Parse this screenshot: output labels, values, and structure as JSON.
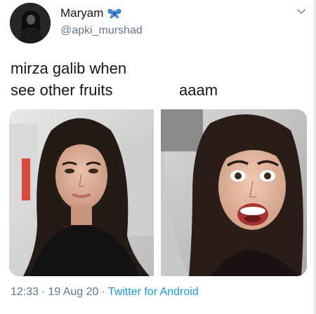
{
  "author": {
    "display_name": "Maryam",
    "handle": "@apki_murshad",
    "name_emoji": "butterfly-icon"
  },
  "tweet": {
    "line1": "mirza galib when",
    "line2": "see other fruits",
    "line2_right": "aaam"
  },
  "meta": {
    "time": "12:33",
    "date": "19 Aug 20",
    "source": "Twitter for Android",
    "separator": "·"
  },
  "colors": {
    "text": "#14171a",
    "secondary": "#657786",
    "link": "#1b95e0",
    "butterfly": "#3a8ee6"
  }
}
